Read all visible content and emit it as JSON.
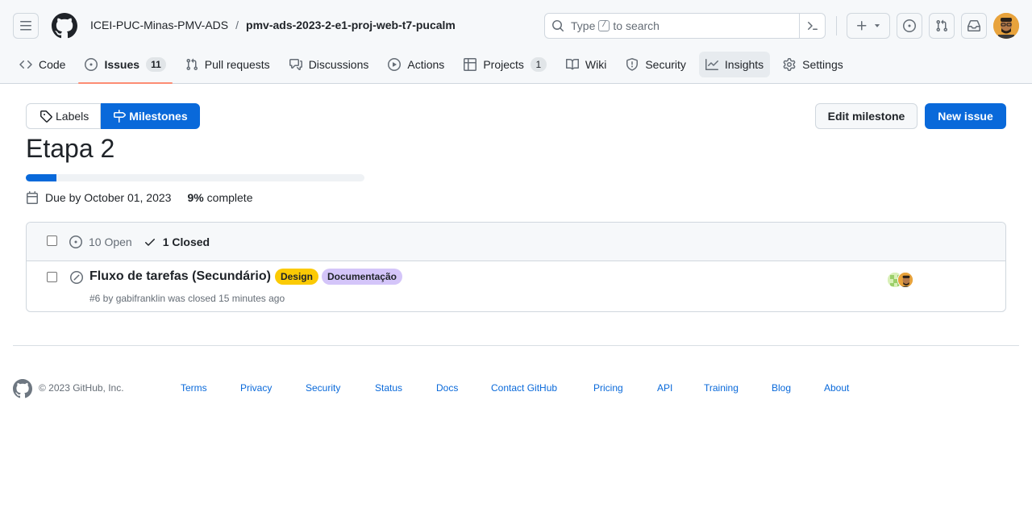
{
  "header": {
    "owner": "ICEI-PUC-Minas-PMV-ADS",
    "separator": "/",
    "repo": "pmv-ads-2023-2-e1-proj-web-t7-pucalm",
    "search": {
      "prefix": "Type",
      "key": "/",
      "suffix": "to search"
    }
  },
  "tabs": [
    {
      "label": "Code",
      "icon": "code-icon"
    },
    {
      "label": "Issues",
      "icon": "issue-opened-icon",
      "count": "11",
      "selected": true
    },
    {
      "label": "Pull requests",
      "icon": "git-pull-request-icon"
    },
    {
      "label": "Discussions",
      "icon": "comment-discussion-icon"
    },
    {
      "label": "Actions",
      "icon": "play-icon"
    },
    {
      "label": "Projects",
      "icon": "table-icon",
      "count": "1"
    },
    {
      "label": "Wiki",
      "icon": "book-icon"
    },
    {
      "label": "Security",
      "icon": "shield-icon"
    },
    {
      "label": "Insights",
      "icon": "graph-icon"
    },
    {
      "label": "Settings",
      "icon": "gear-icon"
    }
  ],
  "subnav": {
    "labels": "Labels",
    "milestones": "Milestones"
  },
  "actions": {
    "edit": "Edit milestone",
    "new_issue": "New issue"
  },
  "milestone": {
    "title": "Etapa 2",
    "progress_percent": 9,
    "due": "Due by October 01, 2023",
    "percent_text": "9%",
    "complete_text": "complete"
  },
  "issues_list": {
    "open_count": "10 Open",
    "closed_count": "1 Closed",
    "items": [
      {
        "title": "Fluxo de tarefas (Secundário)",
        "labels": [
          {
            "name": "Design",
            "color": "#fbca04"
          },
          {
            "name": "Documentação",
            "color": "#d4c5f9"
          }
        ],
        "meta": "#6 by gabifranklin was closed 15 minutes ago"
      }
    ]
  },
  "footer": {
    "copyright": "© 2023 GitHub, Inc.",
    "links": [
      "Terms",
      "Privacy",
      "Security",
      "Status",
      "Docs",
      "Contact GitHub",
      "Pricing",
      "API",
      "Training",
      "Blog",
      "About"
    ]
  },
  "colors": {
    "accent": "#0969da",
    "tab_underline": "#fd8c73"
  }
}
